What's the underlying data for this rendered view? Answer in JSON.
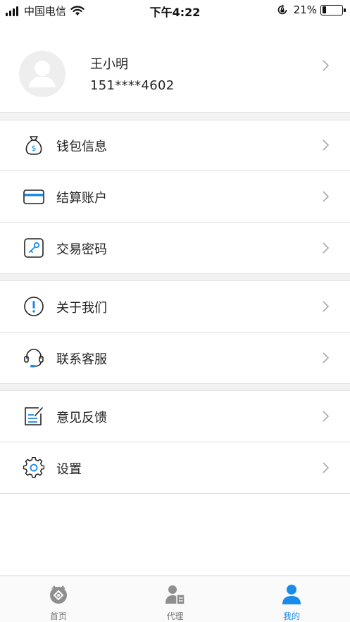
{
  "status_bar": {
    "carrier": "中国电信",
    "time": "下午4:22",
    "battery": "21%",
    "battery_level": 0.21
  },
  "profile": {
    "name": "王小明",
    "phone": "151****4602"
  },
  "menu_groups": [
    [
      {
        "label": "钱包信息",
        "icon": "money-bag-icon"
      },
      {
        "label": "结算账户",
        "icon": "card-icon"
      },
      {
        "label": "交易密码",
        "icon": "key-icon"
      }
    ],
    [
      {
        "label": "关于我们",
        "icon": "info-icon"
      },
      {
        "label": "联系客服",
        "icon": "headset-icon"
      }
    ],
    [
      {
        "label": "意见反馈",
        "icon": "feedback-icon"
      },
      {
        "label": "设置",
        "icon": "gear-icon"
      }
    ]
  ],
  "tabbar": {
    "items": [
      {
        "label": "首页",
        "icon": "home-icon"
      },
      {
        "label": "代理",
        "icon": "agent-icon"
      },
      {
        "label": "我的",
        "icon": "profile-icon"
      }
    ],
    "active_index": 2
  },
  "colors": {
    "accent": "#1a8be8",
    "tab_inactive": "#777777",
    "divider_band": "#f2f2f2"
  }
}
